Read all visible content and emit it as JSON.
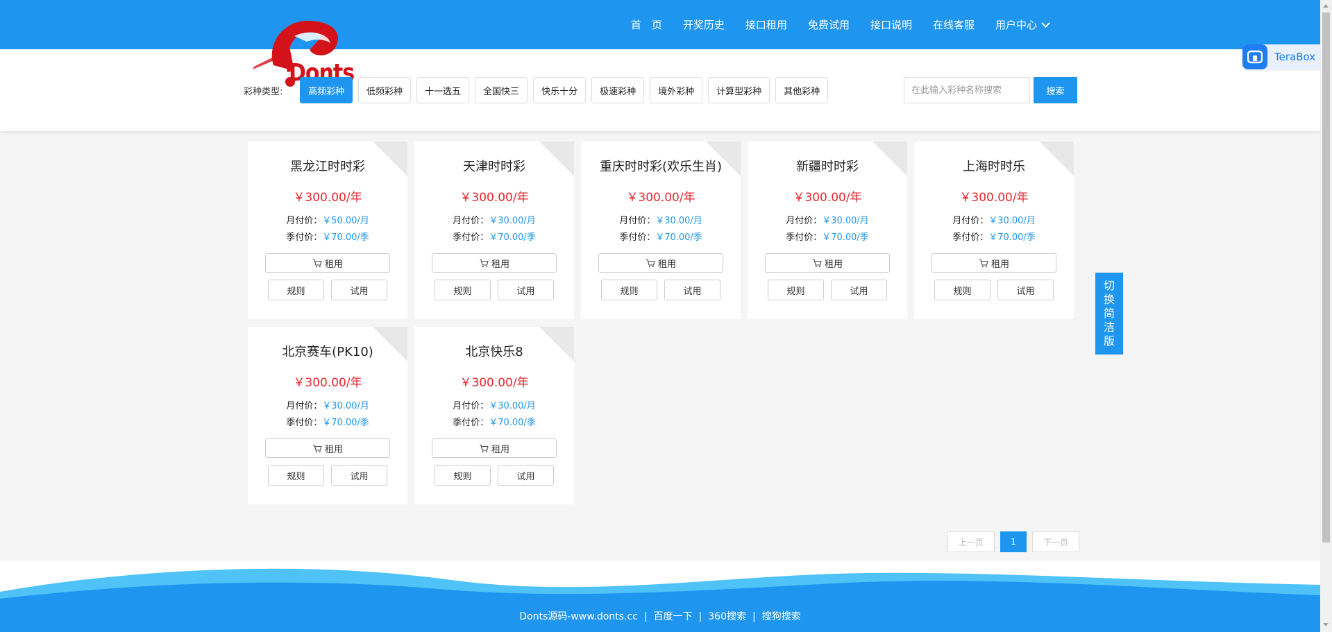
{
  "brand": {
    "logo_text": "Donts",
    "logo_color": "#d4121a"
  },
  "colors": {
    "primary": "#1e96f0",
    "price_red": "#e8262d"
  },
  "nav": {
    "items": [
      {
        "label": "首　页"
      },
      {
        "label": "开奖历史"
      },
      {
        "label": "接口租用"
      },
      {
        "label": "免费试用"
      },
      {
        "label": "接口说明"
      },
      {
        "label": "在线客服"
      },
      {
        "label": "用户中心"
      }
    ]
  },
  "terabox": {
    "label": "TeraBox"
  },
  "filter": {
    "label": "彩种类型:",
    "categories": [
      {
        "label": "高频彩种",
        "active": true
      },
      {
        "label": "低频彩种"
      },
      {
        "label": "十一选五"
      },
      {
        "label": "全国快三"
      },
      {
        "label": "快乐十分"
      },
      {
        "label": "极速彩种"
      },
      {
        "label": "境外彩种"
      },
      {
        "label": "计算型彩种"
      },
      {
        "label": "其他彩种"
      }
    ],
    "search_placeholder": "在此输入彩种名称搜索",
    "search_button": "搜索"
  },
  "card_labels": {
    "monthly": "月付价：",
    "quarterly": "季付价：",
    "rent": "租用",
    "rules": "规则",
    "trial": "试用"
  },
  "cards": [
    {
      "title": "黑龙江时时彩",
      "price": "￥300.00/年",
      "monthly": "￥50.00/月",
      "quarterly": "￥70.00/季"
    },
    {
      "title": "天津时时彩",
      "price": "￥300.00/年",
      "monthly": "￥30.00/月",
      "quarterly": "￥70.00/季"
    },
    {
      "title": "重庆时时彩(欢乐生肖)",
      "price": "￥300.00/年",
      "monthly": "￥30.00/月",
      "quarterly": "￥70.00/季"
    },
    {
      "title": "新疆时时彩",
      "price": "￥300.00/年",
      "monthly": "￥30.00/月",
      "quarterly": "￥70.00/季"
    },
    {
      "title": "上海时时乐",
      "price": "￥300.00/年",
      "monthly": "￥30.00/月",
      "quarterly": "￥70.00/季"
    },
    {
      "title": "北京赛车(PK10)",
      "price": "￥300.00/年",
      "monthly": "￥30.00/月",
      "quarterly": "￥70.00/季"
    },
    {
      "title": "北京快乐8",
      "price": "￥300.00/年",
      "monthly": "￥30.00/月",
      "quarterly": "￥70.00/季"
    }
  ],
  "toggle": {
    "chars": [
      "切",
      "换",
      "简",
      "洁",
      "版"
    ]
  },
  "pagination": {
    "prev": "上一页",
    "current": "1",
    "next": "下一页"
  },
  "footer": {
    "links": [
      "Donts源码-www.donts.cc",
      "百度一下",
      "360搜索",
      "搜狗搜索"
    ],
    "separator": "|"
  }
}
